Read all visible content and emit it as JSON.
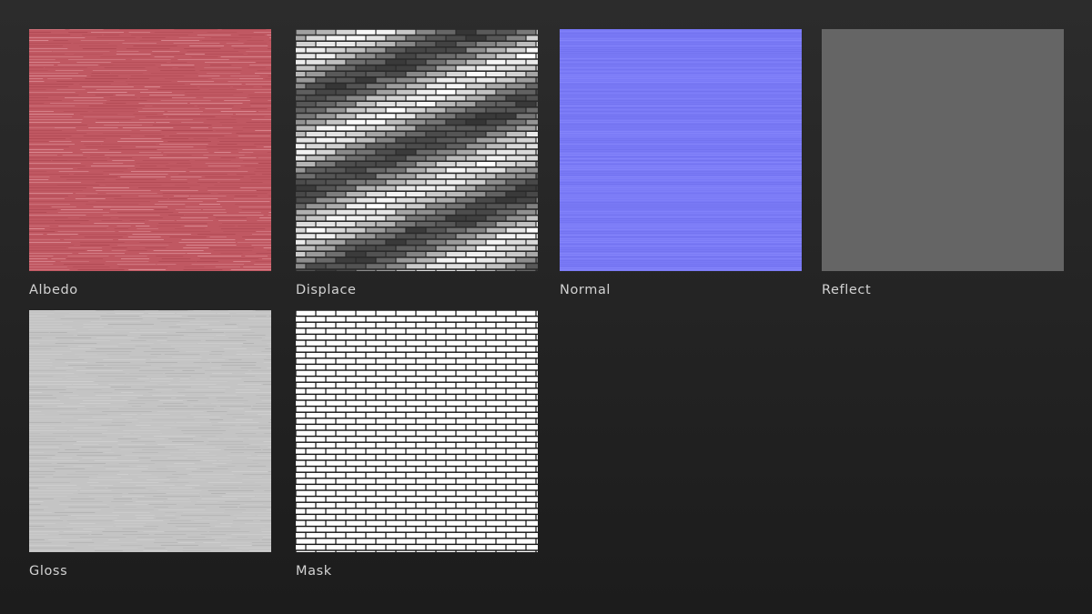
{
  "maps": [
    {
      "id": "albedo",
      "label": "Albedo",
      "base_color": "#c05862",
      "line_color": "#e8a4ab"
    },
    {
      "id": "displace",
      "label": "Displace",
      "base_color": "#3a3a3a",
      "line_color": "#ffffff"
    },
    {
      "id": "normal",
      "label": "Normal",
      "base_color": "#7a7af6",
      "line_color": "#9090ff"
    },
    {
      "id": "reflect",
      "label": "Reflect",
      "base_color": "#656565",
      "line_color": "#656565"
    },
    {
      "id": "gloss",
      "label": "Gloss",
      "base_color": "#c4c4c4",
      "line_color": "#a8a8a8"
    },
    {
      "id": "mask",
      "label": "Mask",
      "base_color": "#ffffff",
      "line_color": "#111111"
    }
  ]
}
